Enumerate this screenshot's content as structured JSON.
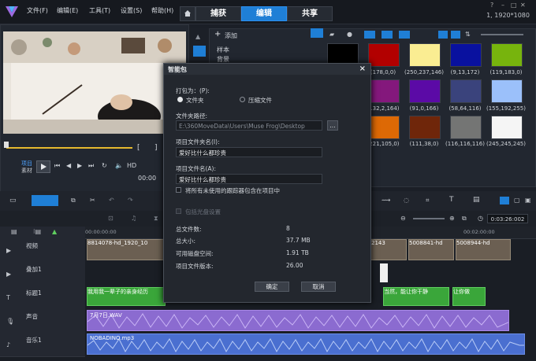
{
  "menu": [
    "文件(F)",
    "编辑(E)",
    "工具(T)",
    "设置(S)",
    "帮助(H)"
  ],
  "tabs": [
    "捕获",
    "编辑",
    "共享"
  ],
  "resolution": "1, 1920*1080",
  "library": {
    "add_label": "添加",
    "folders": [
      "样本",
      "背景"
    ],
    "colors": [
      {
        "hex": "#000000",
        "label": ""
      },
      {
        "hex": "#b20000",
        "label": "(178,0,0)"
      },
      {
        "hex": "#faed92",
        "label": "(250,237,146)"
      },
      {
        "hex": "#09119f",
        "label": "(9,13,172)"
      },
      {
        "hex": "#77b40d",
        "label": "(119,183,0)"
      },
      {
        "hex": "#84187c",
        "label": "(132,2,164)"
      },
      {
        "hex": "#5b0aa6",
        "label": "(91,0,166)"
      },
      {
        "hex": "#3a437c",
        "label": "(58,64,116)"
      },
      {
        "hex": "#9bc0fa",
        "label": "(155,192,255)"
      },
      {
        "hex": "#dd6905",
        "label": "(221,105,0)"
      },
      {
        "hex": "#6f260a",
        "label": "(111,38,0)"
      },
      {
        "hex": "#747574",
        "label": "(116,116,116)"
      },
      {
        "hex": "#f5f5f5",
        "label": "(245,245,245)"
      }
    ]
  },
  "preview": {
    "project_label": "项目",
    "material_label": "素材",
    "hd_label": "HD",
    "timecode": "00:00"
  },
  "dialog": {
    "title": "智能包",
    "package_as_label": "打包为：(P):",
    "option_folder": "文件夹",
    "option_zip": "压缩文件",
    "folder_path_label": "文件夹路径:",
    "folder_path_value": "E:\\360MoveData\\Users\\Muse Frog\\Desktop",
    "browse_label": "...",
    "project_folder_label": "项目文件夹名(I):",
    "project_folder_value": "爱好比什么都珍贵",
    "project_file_label": "项目文件名(A):",
    "project_file_value": "爱好比什么都珍贵",
    "include_unused_label": "将所有未使用的跟踪器包含在项目中",
    "include_disc_label": "包括光盘设置",
    "stats": [
      {
        "label": "总文件数:",
        "value": "8"
      },
      {
        "label": "总大小:",
        "value": "37.7 MB"
      },
      {
        "label": "可用磁盘空间:",
        "value": "1.91 TB"
      },
      {
        "label": "项目文件版本:",
        "value": "26.00"
      }
    ],
    "ok_label": "确定",
    "cancel_label": "取消"
  },
  "timeline": {
    "time_readout": "0:03:26:002",
    "ruler_start": "00:00:00:00",
    "ruler_right": "00:02:00:00",
    "tracks": [
      {
        "name": "视频"
      },
      {
        "name": "叠加1"
      },
      {
        "name": "标题1"
      },
      {
        "name": "声音"
      },
      {
        "name": "音乐1"
      }
    ],
    "video_clips": [
      "8814078-hd_1920_10",
      "2143",
      "5008841-hd",
      "5008944-hd"
    ],
    "title_clips": [
      "我用我一辈子的亲身经历",
      "当然，能让你干静",
      "让你做"
    ],
    "voice_clip": "7月7日.WAV",
    "music_clip": "NOBADINO.mp3"
  },
  "colors": {
    "accent": "#1f7fd6",
    "title_green": "#3aa63a",
    "voice_purple": "#8b6bd0",
    "music_blue": "#4a6fd0"
  }
}
